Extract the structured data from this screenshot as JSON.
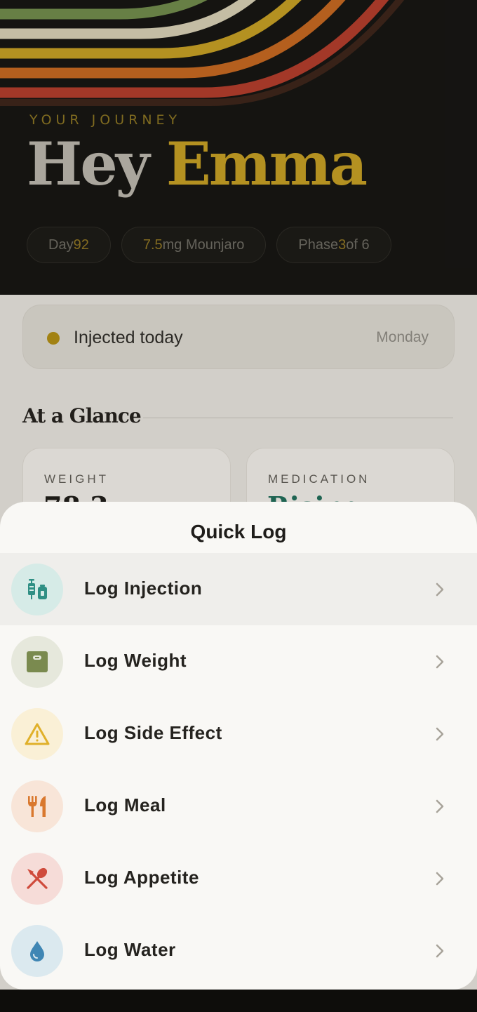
{
  "hero": {
    "eyebrow": "YOUR JOURNEY",
    "greeting_prefix": "Hey",
    "user_name": "Emma",
    "chips": [
      {
        "prefix": "Day ",
        "highlight": "92",
        "suffix": ""
      },
      {
        "prefix": "",
        "highlight": "7.5",
        "suffix": " mg Mounjaro"
      },
      {
        "prefix": "Phase ",
        "highlight": "3",
        "suffix": " of 6"
      }
    ]
  },
  "status_card": {
    "label": "Injected today",
    "day": "Monday"
  },
  "at_a_glance": {
    "title": "At a Glance",
    "cards": [
      {
        "label": "WEIGHT",
        "value": "78.3"
      },
      {
        "label": "MEDICATION",
        "value": "Rising"
      }
    ]
  },
  "quick_log": {
    "title": "Quick Log",
    "items": [
      {
        "label": "Log Injection",
        "icon": "syringe-vial-icon",
        "color": "#2f8f84",
        "bg": "#d6ebe7"
      },
      {
        "label": "Log Weight",
        "icon": "scale-icon",
        "color": "#7a8a4f",
        "bg": "#e6e8dc"
      },
      {
        "label": "Log Side Effect",
        "icon": "warning-icon",
        "color": "#e0b02a",
        "bg": "#faf0d6"
      },
      {
        "label": "Log Meal",
        "icon": "fork-knife-icon",
        "color": "#d9782e",
        "bg": "#f8e5d8"
      },
      {
        "label": "Log Appetite",
        "icon": "spoon-knife-crossed-icon",
        "color": "#cf4b3c",
        "bg": "#f6dcd8"
      },
      {
        "label": "Log Water",
        "icon": "water-drop-icon",
        "color": "#3f86b4",
        "bg": "#dbe9ef"
      }
    ]
  },
  "colors": {
    "accent_gold": "#c59d22",
    "hero_bg": "#131210",
    "sheet_bg": "#f9f8f5"
  }
}
